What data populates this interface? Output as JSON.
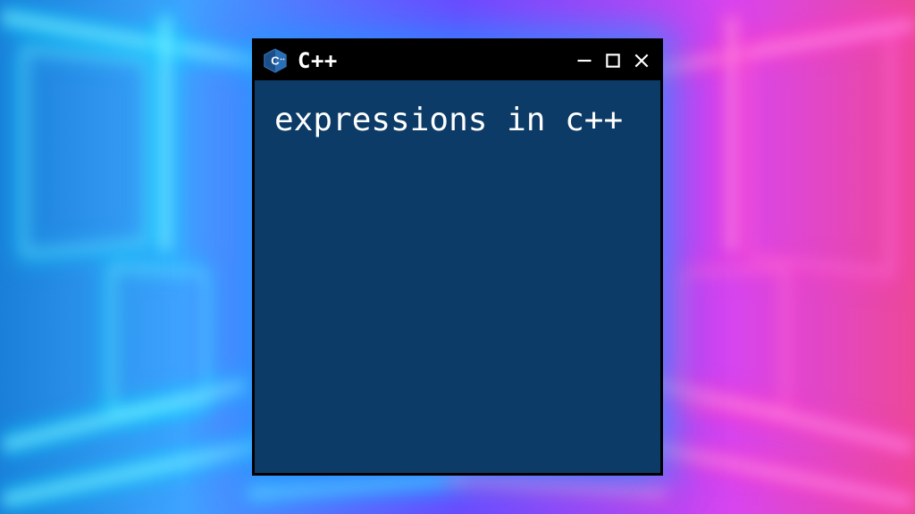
{
  "window": {
    "title": "C++",
    "body_text": "expressions in c++",
    "colors": {
      "titlebar_bg": "#000000",
      "content_bg": "#0b3b66",
      "text": "#ffffff",
      "border": "#000000"
    },
    "icons": {
      "app": "cpp-logo-icon",
      "minimize": "minimize-icon",
      "maximize": "maximize-icon",
      "close": "close-icon"
    }
  },
  "background": {
    "style": "neon-tech-corridor",
    "colors": {
      "left_glow": "#22c3ff",
      "right_glow": "#f24bd8",
      "mid_glow": "#7b4dff"
    }
  }
}
